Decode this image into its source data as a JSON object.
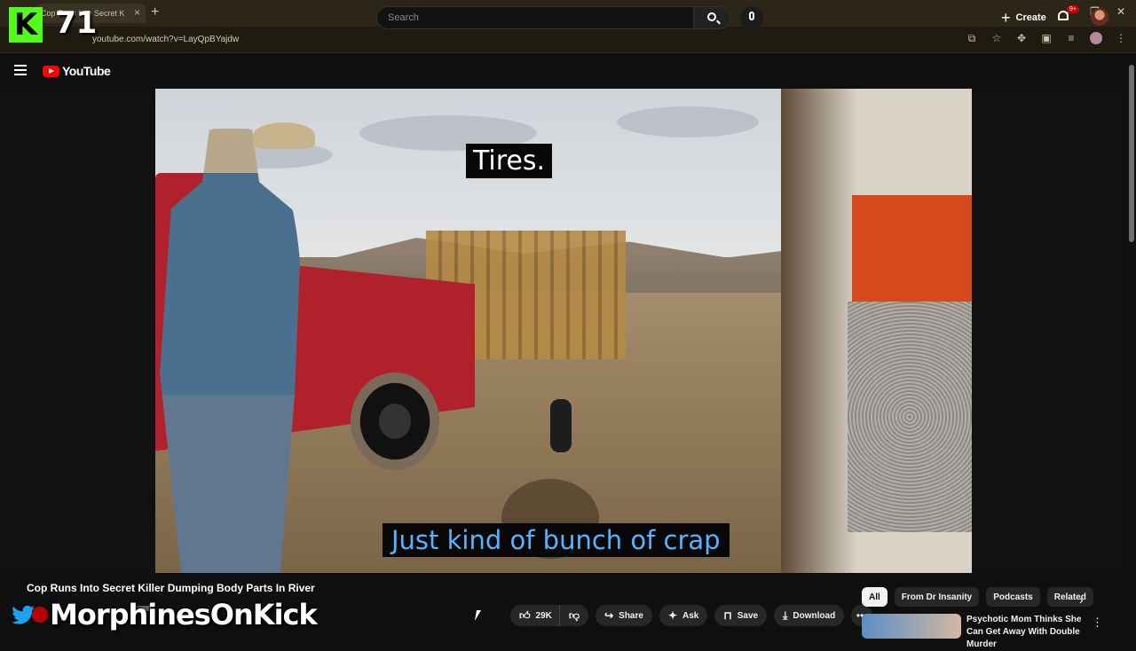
{
  "browser": {
    "tab_title": "Cop Runs Into Secret K",
    "url": "youtube.com/watch?v=LayQpBYajdw",
    "tab_close": "×",
    "new_tab": "+",
    "window_controls": [
      "–",
      "❐",
      "✕"
    ]
  },
  "overlay": {
    "kick_logo": "K",
    "viewer_count": "71",
    "streamer_name": "MorphinesOnKick"
  },
  "header": {
    "logo_text": "YouTube",
    "search_placeholder": "Search",
    "create_label": "Create",
    "notification_badge": "9+"
  },
  "video": {
    "caption_top": "Tires.",
    "caption_bottom": "Just kind of bunch of crap"
  },
  "below": {
    "title": "Cop Runs Into Secret Killer Dumping Body Parts In River",
    "likes": "29K",
    "share_label": "Share",
    "ask_label": "Ask",
    "save_label": "Save",
    "download_label": "Download",
    "more_label": "•••"
  },
  "chips": [
    "All",
    "From Dr Insanity",
    "Podcasts",
    "Related"
  ],
  "recommendation": {
    "title": "Psychotic Mom Thinks She Can Get Away With Double Murder"
  },
  "colors": {
    "kick_green": "#53fc18",
    "youtube_red": "#ff0000",
    "caption_blue": "#54b4ff"
  }
}
